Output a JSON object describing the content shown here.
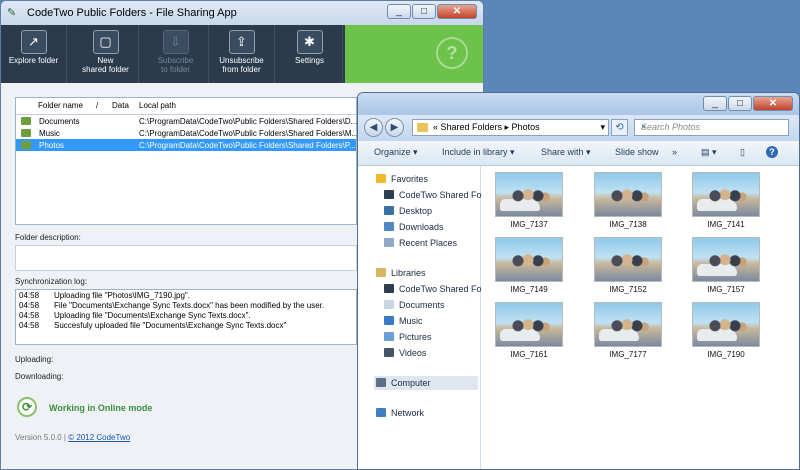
{
  "app": {
    "title": "CodeTwo Public Folders - File Sharing App",
    "window_buttons": [
      "_",
      "□",
      "✕"
    ],
    "ribbon": [
      {
        "label": "Explore folder",
        "icon": "explore-folder-icon",
        "glyph": "↗",
        "enabled": true
      },
      {
        "label": "New\nshared folder",
        "icon": "new-shared-folder-icon",
        "glyph": "▢",
        "enabled": true
      },
      {
        "label": "Subscribe\nto folder",
        "icon": "subscribe-icon",
        "glyph": "⇩",
        "enabled": false
      },
      {
        "label": "Unsubscribe\nfrom folder",
        "icon": "unsubscribe-icon",
        "glyph": "⇪",
        "enabled": true
      },
      {
        "label": "Settings",
        "icon": "settings-icon",
        "glyph": "✱",
        "enabled": true
      }
    ],
    "help_glyph": "?",
    "table": {
      "headers": {
        "name": "Folder name",
        "sep": "/",
        "data": "Data",
        "path": "Local path"
      },
      "rows": [
        {
          "name": "Documents",
          "path": "C:\\ProgramData\\CodeTwo\\Public Folders\\Shared Folders\\D...",
          "selected": false
        },
        {
          "name": "Music",
          "path": "C:\\ProgramData\\CodeTwo\\Public Folders\\Shared Folders\\M...",
          "selected": false
        },
        {
          "name": "Photos",
          "path": "C:\\ProgramData\\CodeTwo\\Public Folders\\Shared Folders\\P...",
          "selected": true
        }
      ]
    },
    "folder_description_label": "Folder description:",
    "sync_log_label": "Synchronization log:",
    "log": [
      {
        "time": "04:58",
        "message": "Uploading file \"Photos\\IMG_7190.jpg\"."
      },
      {
        "time": "04:58",
        "message": "File \"Documents\\Exchange Sync Texts.docx\" has been modified by the user."
      },
      {
        "time": "04:58",
        "message": "Uploading file \"Documents\\Exchange Sync Texts.docx\"."
      },
      {
        "time": "04:58",
        "message": "Succesfuly uploaded file \"Documents\\Exchange Sync Texts.docx\""
      }
    ],
    "uploading_label": "Uploading:",
    "downloading_label": "Downloading:",
    "status": "Working in Online mode",
    "version": "Version 5.0.0 |",
    "copyright": "© 2012 CodeTwo"
  },
  "explorer": {
    "window_buttons": [
      "_",
      "□",
      "✕"
    ],
    "breadcrumb": "« Shared Folders ▸ Photos",
    "search_placeholder": "Search Photos",
    "commands": [
      "Organize ▾",
      "Include in library ▾",
      "Share with ▾",
      "Slide show",
      "»"
    ],
    "nav": {
      "favorites_label": "Favorites",
      "favorites": [
        "CodeTwo Shared Fo",
        "Desktop",
        "Downloads",
        "Recent Places"
      ],
      "libraries_label": "Libraries",
      "libraries": [
        "CodeTwo Shared Fo",
        "Documents",
        "Music",
        "Pictures",
        "Videos"
      ],
      "computer": "Computer",
      "network": "Network"
    },
    "files": [
      "IMG_7137",
      "IMG_7138",
      "IMG_7141",
      "IMG_7149",
      "IMG_7152",
      "IMG_7157",
      "IMG_7161",
      "IMG_7177",
      "IMG_7190"
    ]
  },
  "colors": {
    "ribbon_dark": "#2b3b4c",
    "ribbon_green": "#6cc24a",
    "selection": "#3399ff",
    "online_green": "#3c8f3c",
    "desktop": "#5a87b8"
  }
}
